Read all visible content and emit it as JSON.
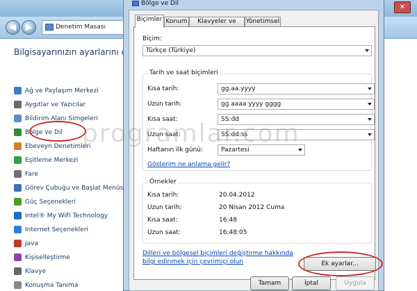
{
  "background": {
    "address_text": "Denetim Masası",
    "heading": "Bilgisayarınızın ayarlarını düzenleyin",
    "items": [
      {
        "label": "Ağ ve Paylaşım Merkezi",
        "icon": "network-icon",
        "color": "#3d7cc9"
      },
      {
        "label": "Aygıtlar ve Yazıcılar",
        "icon": "printer-icon",
        "color": "#6b6b6b"
      },
      {
        "label": "Bildirim Alanı Simgeleri",
        "icon": "tray-icon",
        "color": "#5b8fc8"
      },
      {
        "label": "Bölge ve Dil",
        "icon": "globe-icon",
        "color": "#2f8f3a"
      },
      {
        "label": "Ebeveyn Denetimleri",
        "icon": "family-icon",
        "color": "#d4802a"
      },
      {
        "label": "Eşitleme Merkezi",
        "icon": "sync-icon",
        "color": "#2ea043"
      },
      {
        "label": "Fare",
        "icon": "mouse-icon",
        "color": "#707070"
      },
      {
        "label": "Görev Çubuğu ve Başlat Menüsü",
        "icon": "taskbar-icon",
        "color": "#3b6fb6"
      },
      {
        "label": "Güç Seçenekleri",
        "icon": "power-icon",
        "color": "#4c9a2a"
      },
      {
        "label": "Intel® My WiFi Technology",
        "icon": "wifi-icon",
        "color": "#1a6fc2"
      },
      {
        "label": "Internet Seçenekleri",
        "icon": "internet-icon",
        "color": "#2d7fd3"
      },
      {
        "label": "Java",
        "icon": "java-icon",
        "color": "#c0392b"
      },
      {
        "label": "Kişiselleştirme",
        "icon": "personalize-icon",
        "color": "#8e44ad"
      },
      {
        "label": "Klavye",
        "icon": "keyboard-icon",
        "color": "#666666"
      },
      {
        "label": "Konuşma Tanıma",
        "icon": "microphone-icon",
        "color": "#888888"
      }
    ]
  },
  "dialog": {
    "title": "Bölge ve Dil",
    "tabs": [
      "Biçimler",
      "Konum",
      "Klavyeler ve Diller",
      "Yönetimsel"
    ],
    "format_label": "Biçim:",
    "format_value": "Türkçe (Türkiye)",
    "datetime_group_title": "Tarih ve saat biçimleri",
    "fields": [
      {
        "label": "Kısa tarih:",
        "value": "gg.aa.yyyy"
      },
      {
        "label": "Uzun tarih:",
        "value": "gg aaaa yyyy gggg"
      },
      {
        "label": "Kısa saat:",
        "value": "SS:dd"
      },
      {
        "label": "Uzun saat:",
        "value": "SS:dd:ss"
      },
      {
        "label": "Haftanın ilk günü:",
        "value": "Pazartesi"
      }
    ],
    "notation_link": "Gösterim ne anlama gelir?",
    "examples_group_title": "Örnekler",
    "examples": [
      {
        "label": "Kısa tarih:",
        "value": "20.04.2012"
      },
      {
        "label": "Uzun tarih:",
        "value": "20 Nisan 2012 Cuma"
      },
      {
        "label": "Kısa saat:",
        "value": "16:48"
      },
      {
        "label": "Uzun saat:",
        "value": "16:48:05"
      }
    ],
    "info_link_line1": "Dilleri ve bölgesel biçimleri değiştirme hakkında",
    "info_link_line2": "bilgi edinmek için çevrimiçi olun",
    "additional_settings_button": "Ek ayarlar...",
    "ok_button": "Tamam",
    "cancel_button": "İptal",
    "apply_button": "Uygula"
  },
  "watermark": "programlar.com",
  "colors": {
    "highlight_circle": "#c82a2a",
    "link": "#0645ad",
    "titlebar": "#bcd3ea"
  }
}
